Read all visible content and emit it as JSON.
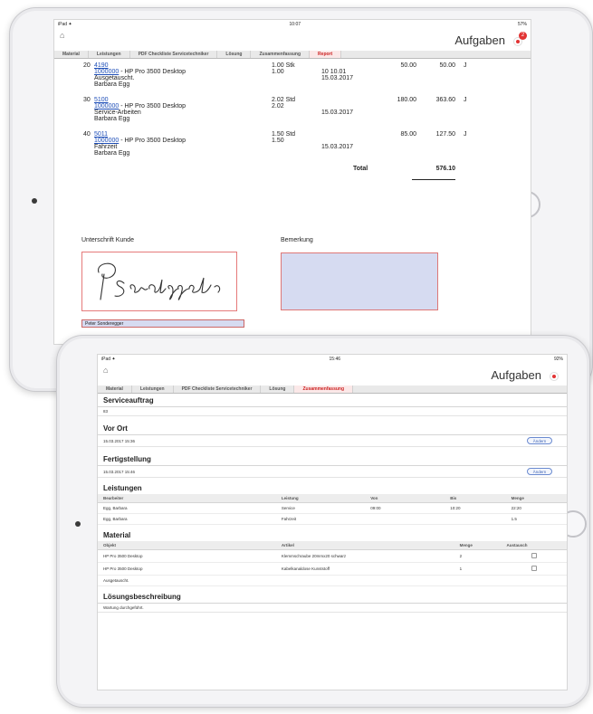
{
  "top": {
    "status": {
      "left": "iPad ✦",
      "time": "10:07",
      "battery": "57%"
    },
    "nav": {
      "title": "Aufgaben",
      "badge": "2"
    },
    "tabs": [
      "Material",
      "Leistungen",
      "PDF Checkliste Servicetechniker",
      "Lösung",
      "Zusammenfassung",
      "Report"
    ],
    "active_tab": "Report",
    "rows": [
      {
        "pos": "20",
        "code": "4190",
        "article": "1000000",
        "article_rest": " - HP Pro 3500 Desktop",
        "text": "Ausgetauscht.",
        "person": "Barbara Egg",
        "qty": "1.00 Stk",
        "qty2": "1.00",
        "ref": "10 10.01",
        "date": "15.03.2017",
        "price": "50.00",
        "amount": "50.00",
        "flag": "J"
      },
      {
        "pos": "30",
        "code": "5100",
        "article": "1000000",
        "article_rest": " - HP Pro 3500 Desktop",
        "text": "Service-Arbeiten",
        "person": "Barbara Egg",
        "qty": "2.02 Std",
        "qty2": "2.02",
        "ref": "",
        "date": "15.03.2017",
        "price": "180.00",
        "amount": "363.60",
        "flag": "J"
      },
      {
        "pos": "40",
        "code": "5011",
        "article": "1000000",
        "article_rest": " - HP Pro 3500 Desktop",
        "text": "Fahrzeit",
        "person": "Barbara Egg",
        "qty": "1.50 Std",
        "qty2": "1.50",
        "ref": "",
        "date": "15.03.2017",
        "price": "85.00",
        "amount": "127.50",
        "flag": "J"
      }
    ],
    "total_label": "Total",
    "total_value": "576.10",
    "signature_label": "Unterschrift Kunde",
    "signer_name": "Peter Sonderegger",
    "remark_label": "Bemerkung"
  },
  "bottom": {
    "status": {
      "left": "iPad ✦",
      "time": "15:46",
      "battery": "92%"
    },
    "nav": {
      "title": "Aufgaben"
    },
    "tabs": [
      "Material",
      "Leistungen",
      "PDF Checkliste Servicetechniker",
      "Lösung",
      "Zusammenfassung"
    ],
    "active_tab": "Zusammenfassung",
    "serviceauftrag": {
      "title": "Serviceauftrag",
      "value": "83"
    },
    "vor_ort": {
      "title": "Vor Ort",
      "value": "15.03.2017 15:36",
      "button": "Ändern"
    },
    "fertigstellung": {
      "title": "Fertigstellung",
      "value": "15.03.2017 15:46",
      "button": "Ändern"
    },
    "leistungen": {
      "title": "Leistungen",
      "headers": [
        "Bearbeiter",
        "Leistung",
        "Von",
        "Bis",
        "Menge"
      ],
      "rows": [
        [
          "Egg, Barbara",
          "Service",
          "09:00",
          "10:20",
          "22:20"
        ],
        [
          "Egg, Barbara",
          "Fahrzeit",
          "",
          "",
          "1.5"
        ]
      ]
    },
    "material": {
      "title": "Material",
      "headers": [
        "Objekt",
        "Artikel",
        "Menge",
        "Austausch"
      ],
      "rows": [
        [
          "HP Pro 3500 Desktop",
          "Klemmschraube 20mmx20 schwarz",
          "2",
          ""
        ],
        [
          "HP Pro 3500 Desktop",
          "Kabelkanaldose Kunststoff",
          "1",
          ""
        ]
      ],
      "note": "Ausgetauscht."
    },
    "loesung": {
      "title": "Lösungsbeschreibung",
      "value": "Wartung durchgeführt."
    }
  }
}
